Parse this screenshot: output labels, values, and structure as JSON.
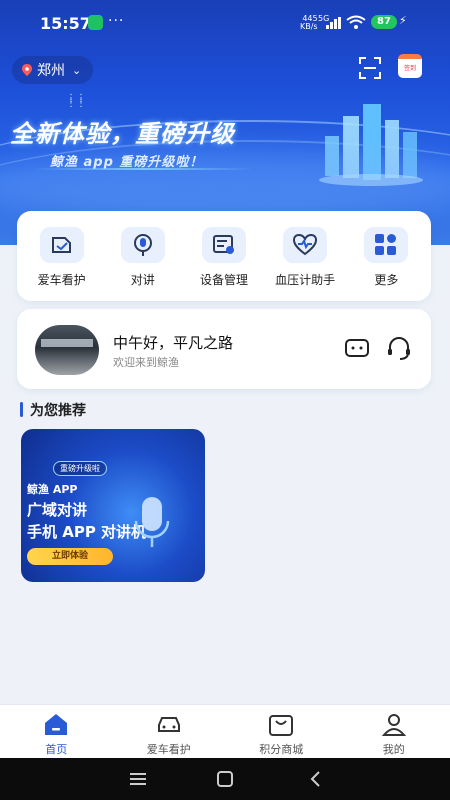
{
  "status_bar": {
    "time": "15:57",
    "more_indicator": "···",
    "net_speed_value": "445",
    "net_speed_unit": "KB/s",
    "network_type": "5G",
    "battery": "87",
    "charging_icon": "bolt-icon"
  },
  "header": {
    "city": "郑州",
    "scan_icon": "scan-icon",
    "checkin_label": "签到"
  },
  "banner": {
    "headline": "全新体验，重磅升级",
    "subline": "鲸渔 app 重磅升级啦！"
  },
  "quick_actions": [
    {
      "label": "爱车看护",
      "icon": "car-care-icon"
    },
    {
      "label": "对讲",
      "icon": "intercom-icon"
    },
    {
      "label": "设备管理",
      "icon": "device-manage-icon"
    },
    {
      "label": "血压计助手",
      "icon": "blood-pressure-icon"
    },
    {
      "label": "更多",
      "icon": "more-grid-icon"
    }
  ],
  "greeting": {
    "title": "中午好，平凡之路",
    "subtitle": "欢迎来到鲸渔"
  },
  "recommend": {
    "section_title": "为您推荐",
    "promo": {
      "tag": "重磅升级啦",
      "line1": "鲸渔 APP",
      "line2": "广域对讲",
      "line3": "手机 APP 对讲机",
      "cta": "立即体验"
    }
  },
  "tabs": [
    {
      "label": "首页",
      "active": true
    },
    {
      "label": "爱车看护",
      "active": false
    },
    {
      "label": "积分商城",
      "active": false
    },
    {
      "label": "我的",
      "active": false
    }
  ],
  "colors": {
    "accent": "#2a5bd7",
    "battery": "#22c55e",
    "banner_top": "#1a3fb8"
  }
}
